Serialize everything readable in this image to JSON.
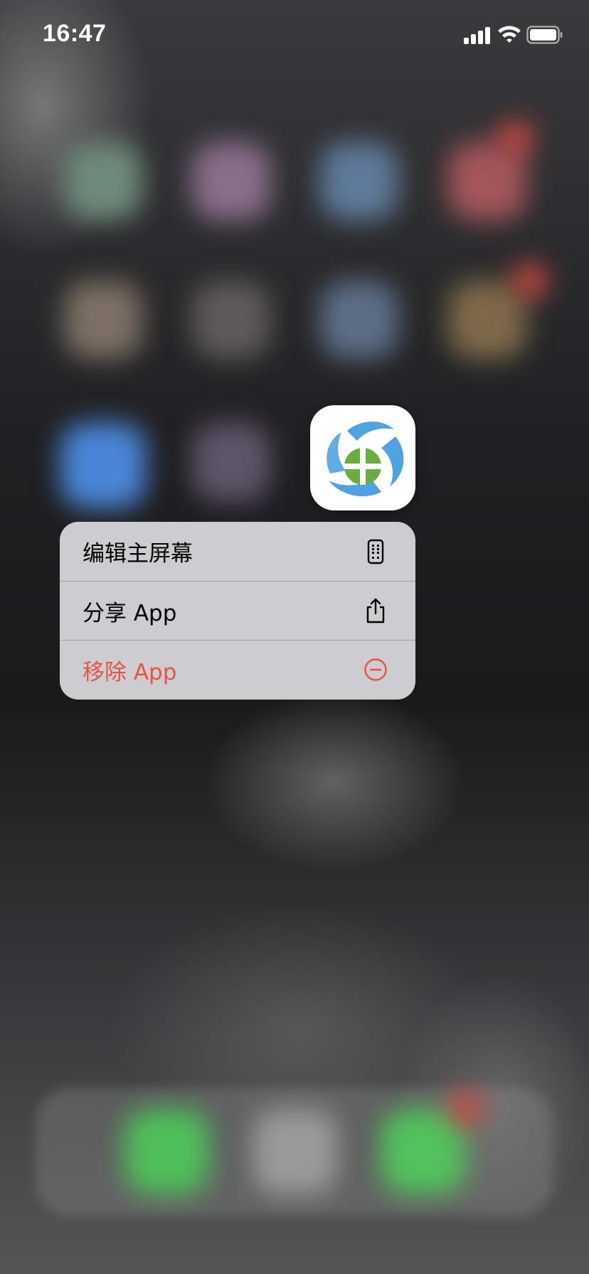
{
  "status_bar": {
    "time": "16:47",
    "signal_icon": "cellular-signal-icon",
    "wifi_icon": "wifi-icon",
    "battery_icon": "battery-icon"
  },
  "focused_app": {
    "icon": "app-icon"
  },
  "context_menu": {
    "items": [
      {
        "label": "编辑主屏幕",
        "icon": "phone-screen-icon"
      },
      {
        "label": "分享 App",
        "icon": "share-icon"
      },
      {
        "label": "移除 App",
        "icon": "minus-circle-icon",
        "destructive_color": "#e5534b"
      }
    ]
  },
  "colors": {
    "menu_background": "#d4d4d6",
    "destructive": "#e5534b",
    "app_icon_blue": "#4fa3e0",
    "app_icon_green": "#6aac3f"
  }
}
